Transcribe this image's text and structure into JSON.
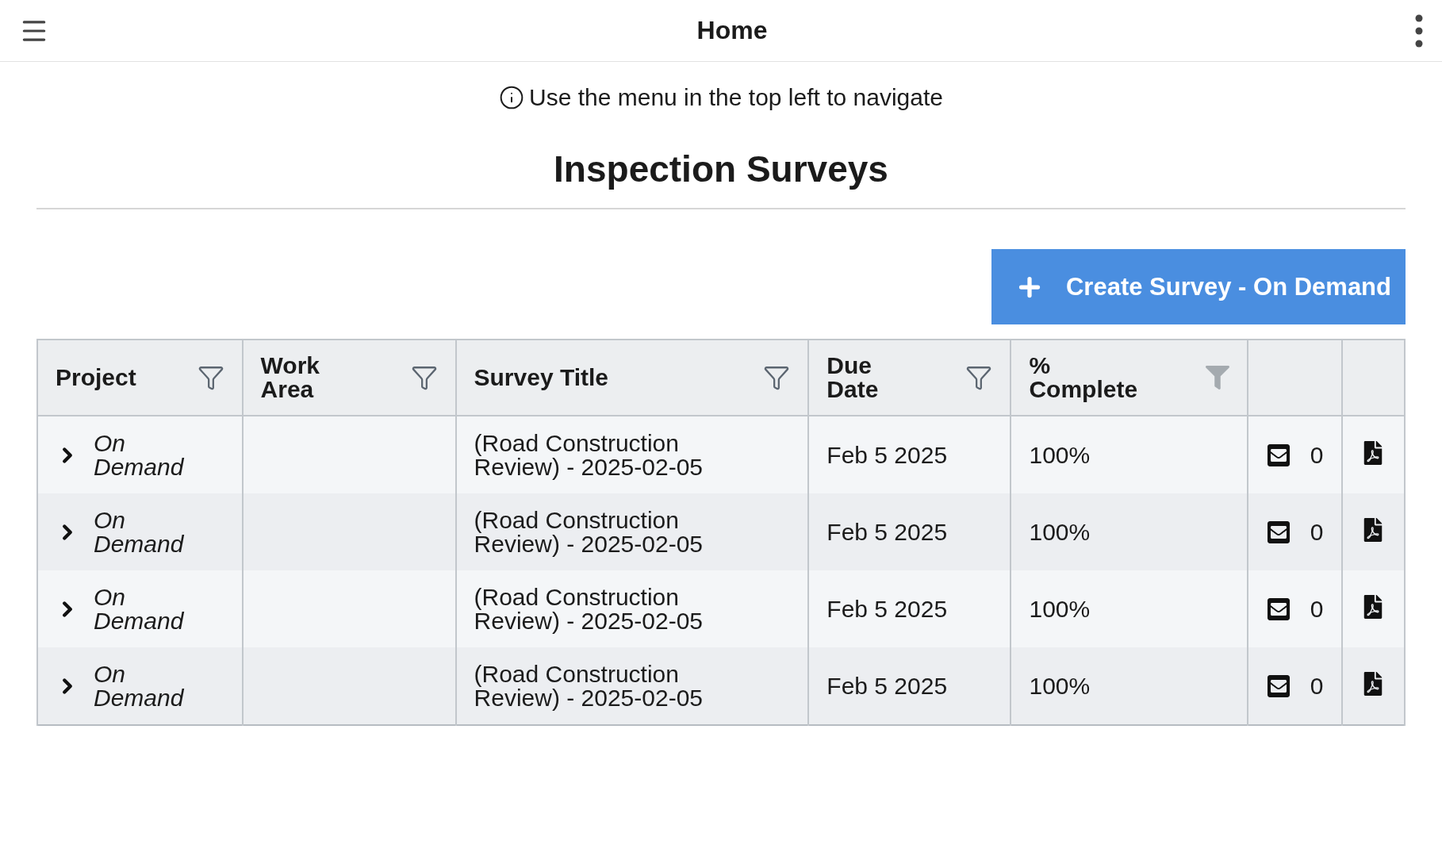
{
  "app_bar": {
    "title": "Home"
  },
  "notice": {
    "text": "Use the menu in the top left to navigate"
  },
  "heading": "Inspection Surveys",
  "create_button": {
    "label": "Create Survey - On Demand"
  },
  "table": {
    "columns": [
      {
        "label": "Project",
        "filter_applied": false
      },
      {
        "label": "Work Area",
        "filter_applied": false
      },
      {
        "label": "Survey Title",
        "filter_applied": false
      },
      {
        "label": "Due Date",
        "filter_applied": false
      },
      {
        "label": "% Complete",
        "filter_applied": true
      }
    ],
    "rows": [
      {
        "project": "On Demand",
        "survey_title": "(Road Construction Review) - 2025-02-05",
        "due_date": "Feb 5 2025",
        "percent_complete": "100%",
        "message_count": "0",
        "expanded": false
      },
      {
        "project": "On Demand",
        "survey_title": "(Road Construction Review) - 2025-02-05",
        "due_date": "Feb 5 2025",
        "percent_complete": "100%",
        "message_count": "0",
        "expanded": false
      },
      {
        "project": "On Demand",
        "survey_title": "(Road Construction Review) - 2025-02-05",
        "due_date": "Feb 5 2025",
        "percent_complete": "100%",
        "message_count": "0",
        "expanded": false
      },
      {
        "project": "On Demand",
        "survey_title": "(Road Construction Review) - 2025-02-05",
        "due_date": "Feb 5 2025",
        "percent_complete": "100%",
        "message_count": "0",
        "expanded": false
      }
    ]
  }
}
